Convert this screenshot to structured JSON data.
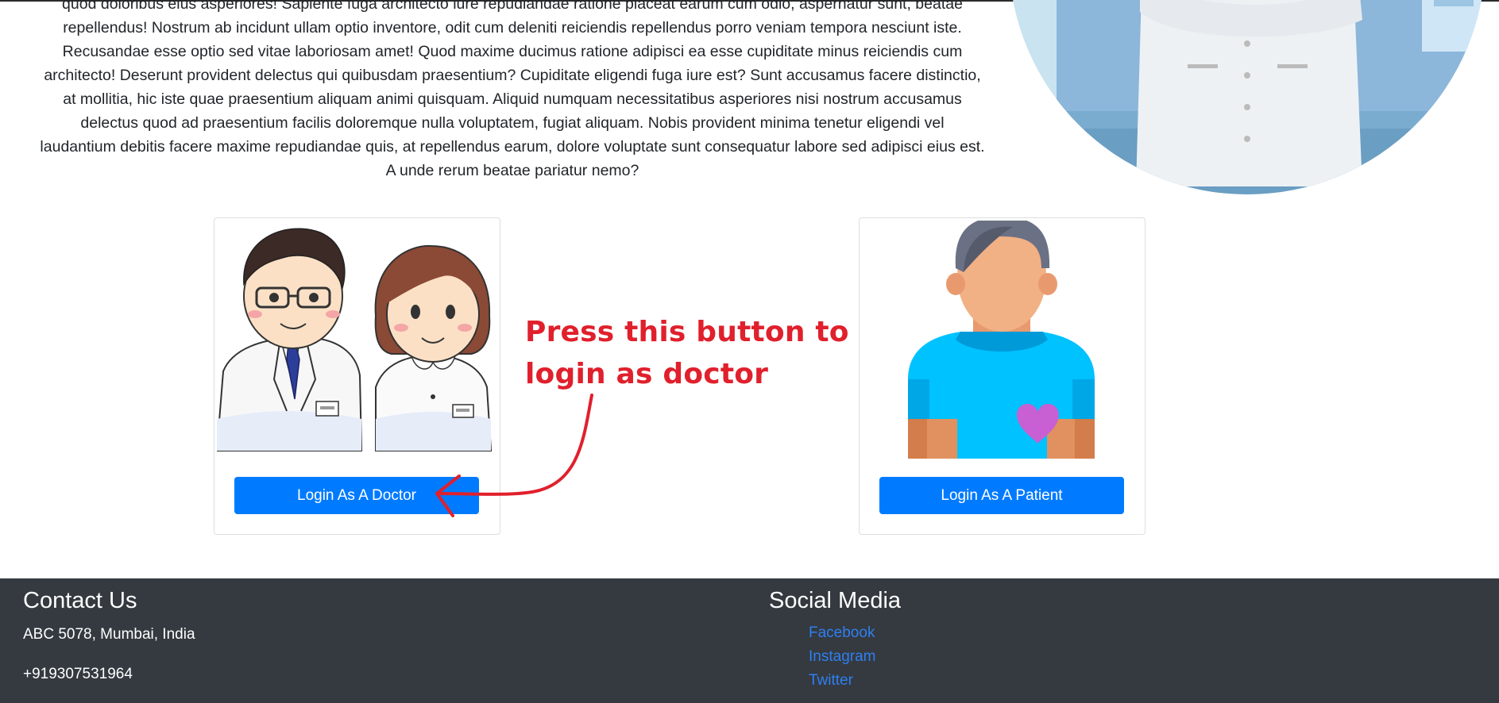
{
  "intro": {
    "lines": [
      "quod doloribus eius asperiores! Sapiente fuga architecto iure repudiandae ratione placeat earum cum odio, aspernatur sunt, beatae",
      "repellendus! Nostrum ab incidunt ullam optio inventore, odit cum deleniti reiciendis repellendus porro veniam tempora nesciunt iste.",
      "Recusandae esse optio sed vitae laboriosam amet! Quod maxime ducimus ratione adipisci ea esse cupiditate minus reiciendis cum",
      "architecto! Deserunt provident delectus qui quibusdam praesentium? Cupiditate eligendi fuga iure est? Sunt accusamus facere distinctio,",
      "at mollitia, hic iste quae praesentium aliquam animi quisquam. Aliquid numquam necessitatibus asperiores nisi nostrum accusamus",
      "delectus quod ad praesentium facilis doloremque nulla voluptatem, fugiat aliquam. Nobis provident minima tenetur eligendi vel",
      "laudantium debitis facere maxime repudiandae quis, at repellendus earum, dolore voluptate sunt consequatur labore sed adipisci eius est.",
      "A unde rerum beatae pariatur nemo?"
    ]
  },
  "cards": {
    "doctor": {
      "button_label": "Login As A Doctor"
    },
    "patient": {
      "button_label": "Login As A Patient"
    }
  },
  "annotation": {
    "line1": "Press this button to",
    "line2": "login as doctor",
    "color": "#e0202c"
  },
  "footer": {
    "contact": {
      "title": "Contact Us",
      "address": "ABC 5078, Mumbai, India",
      "phone": "+919307531964"
    },
    "social": {
      "title": "Social Media",
      "links": [
        "Facebook",
        "Instagram",
        "Twitter"
      ]
    }
  },
  "colors": {
    "primary_button": "#007bff",
    "footer_bg": "#343a40",
    "link": "#2f7ff0"
  },
  "icons": [
    "doctor-hero-illustration",
    "doctors-illustration",
    "patient-illustration",
    "arrow-annotation"
  ]
}
